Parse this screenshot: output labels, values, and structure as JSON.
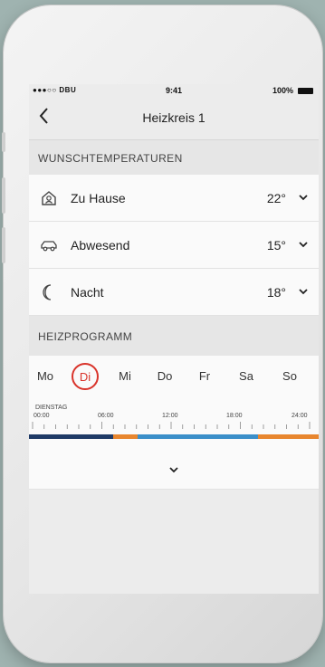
{
  "status_bar": {
    "carrier": "●●●○○ DBU",
    "time": "9:41",
    "battery": "100%"
  },
  "nav": {
    "title": "Heizkreis 1",
    "back_icon": "chevron-left-icon"
  },
  "wunsch": {
    "header": "WUNSCHTEMPERATUREN",
    "items": [
      {
        "label": "Zu Hause",
        "value": "22°",
        "icon": "home-icon"
      },
      {
        "label": "Abwesend",
        "value": "15°",
        "icon": "car-icon"
      },
      {
        "label": "Nacht",
        "value": "18°",
        "icon": "moon-icon"
      }
    ]
  },
  "program": {
    "header": "HEIZPROGRAMM",
    "days": [
      "Mo",
      "Di",
      "Mi",
      "Do",
      "Fr",
      "Sa",
      "So"
    ],
    "selected_day": "Di",
    "timeline": {
      "day_label": "DIENSTAG",
      "hours": [
        "00:00",
        "06:00",
        "12:00",
        "18:00",
        "24:00"
      ],
      "segments": [
        {
          "from": 0,
          "to": 7,
          "color": "#1f3a66"
        },
        {
          "from": 7,
          "to": 9,
          "color": "#e8862e"
        },
        {
          "from": 9,
          "to": 19,
          "color": "#3b8fc9"
        },
        {
          "from": 19,
          "to": 24,
          "color": "#e8862e"
        }
      ]
    }
  },
  "colors": {
    "accent": "#d9342b",
    "night": "#1f3a66",
    "home": "#e8862e",
    "away": "#3b8fc9"
  }
}
